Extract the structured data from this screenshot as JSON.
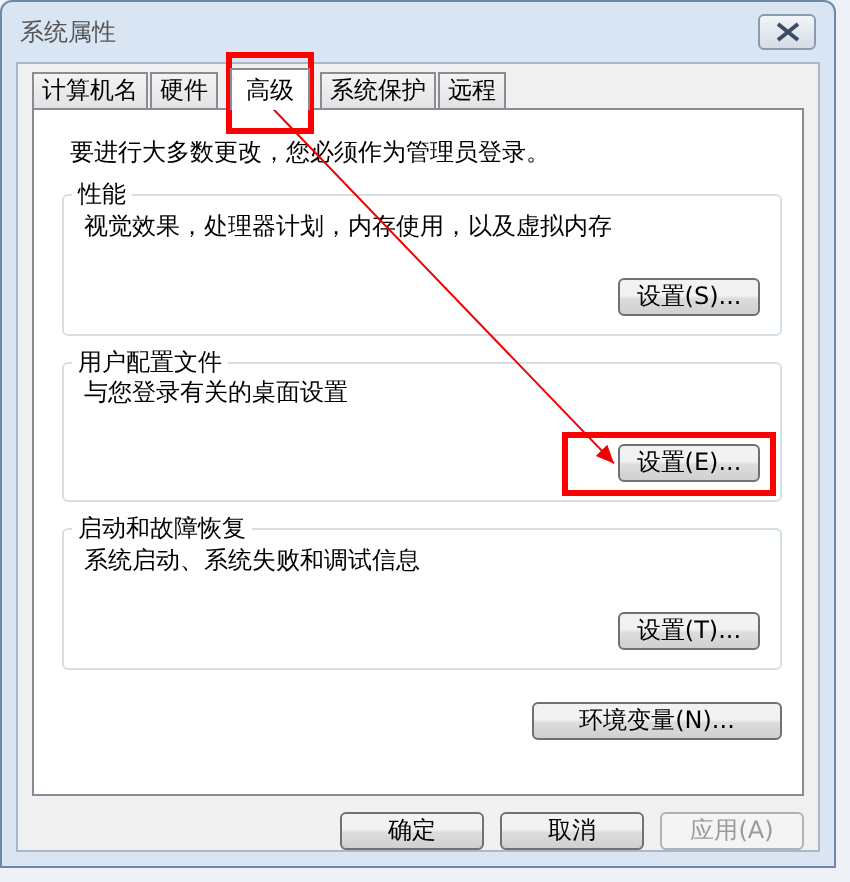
{
  "window": {
    "title": "系统属性"
  },
  "tabs": [
    {
      "label": "计算机名",
      "selected": false,
      "highlighted": false
    },
    {
      "label": "硬件",
      "selected": false,
      "highlighted": false
    },
    {
      "label": "高级",
      "selected": true,
      "highlighted": true
    },
    {
      "label": "系统保护",
      "selected": false,
      "highlighted": false
    },
    {
      "label": "远程",
      "selected": false,
      "highlighted": false
    }
  ],
  "notice": "要进行大多数更改，您必须作为管理员登录。",
  "groups": [
    {
      "title": "性能",
      "description": "视觉效果，处理器计划，内存使用，以及虚拟内存",
      "button": {
        "label": "设置(S)...",
        "highlighted": false
      }
    },
    {
      "title": "用户配置文件",
      "description": "与您登录有关的桌面设置",
      "button": {
        "label": "设置(E)...",
        "highlighted": true
      }
    },
    {
      "title": "启动和故障恢复",
      "description": "系统启动、系统失败和调试信息",
      "button": {
        "label": "设置(T)...",
        "highlighted": false
      }
    }
  ],
  "env_button": "环境变量(N)...",
  "footer_buttons": [
    {
      "label": "确定",
      "disabled": false
    },
    {
      "label": "取消",
      "disabled": false
    },
    {
      "label": "应用(A)",
      "disabled": true
    }
  ],
  "annotation": {
    "arrow": true
  }
}
